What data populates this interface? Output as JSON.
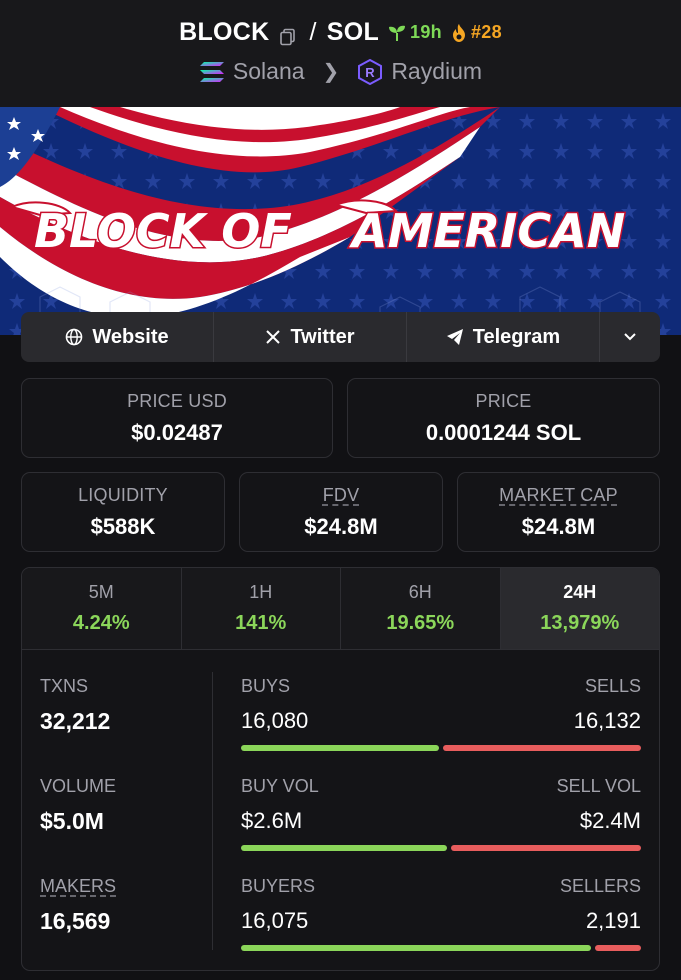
{
  "header": {
    "base_token": "BLOCK",
    "separator": "/",
    "quote_token": "SOL",
    "age": "19h",
    "rank": "#28",
    "chain": "Solana",
    "dex": "Raydium"
  },
  "banner": {
    "text_left": "BLOCK OF",
    "text_right": "AMERICAN"
  },
  "social": {
    "website": "Website",
    "twitter": "Twitter",
    "telegram": "Telegram"
  },
  "prices": {
    "price_usd_label": "PRICE USD",
    "price_usd": "$0.02487",
    "price_label": "PRICE",
    "price_native": "0.0001244 SOL"
  },
  "metrics": {
    "liquidity_label": "LIQUIDITY",
    "liquidity": "$588K",
    "fdv_label": "FDV",
    "fdv": "$24.8M",
    "mcap_label": "MARKET CAP",
    "mcap": "$24.8M"
  },
  "timeframes": [
    {
      "label": "5M",
      "change": "4.24%"
    },
    {
      "label": "1H",
      "change": "141%"
    },
    {
      "label": "6H",
      "change": "19.65%"
    },
    {
      "label": "24H",
      "change": "13,979%"
    }
  ],
  "stats": {
    "txns_label": "TXNS",
    "txns": "32,212",
    "volume_label": "VOLUME",
    "volume": "$5.0M",
    "makers_label": "MAKERS",
    "makers": "16,569",
    "buys_label": "BUYS",
    "buys": "16,080",
    "sells_label": "SELLS",
    "sells": "16,132",
    "buy_vol_label": "BUY VOL",
    "buy_vol": "$2.6M",
    "sell_vol_label": "SELL VOL",
    "sell_vol": "$2.4M",
    "buyers_label": "BUYERS",
    "buyers": "16,075",
    "sellers_label": "SELLERS",
    "sellers": "2,191"
  },
  "ratios": {
    "buys_share": 0.4992,
    "buy_vol_share": 0.52,
    "buyers_share": 0.88
  },
  "colors": {
    "positive": "#8bd65a",
    "negative": "#e85d5d",
    "rank": "#f5a623"
  }
}
